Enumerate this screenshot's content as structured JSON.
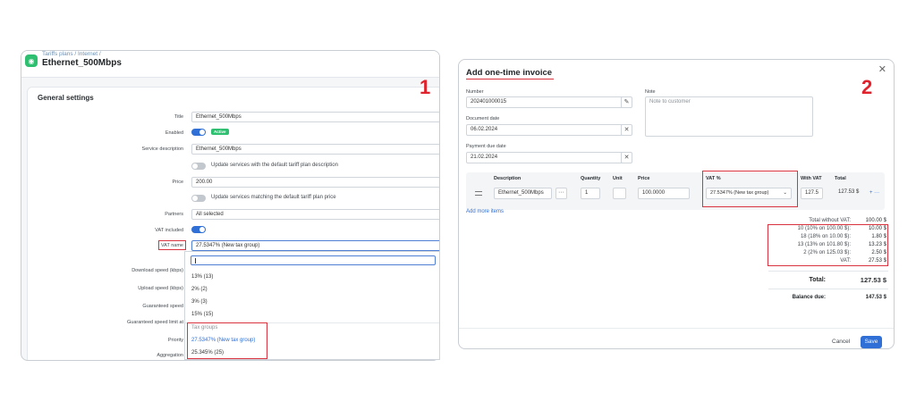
{
  "panel1": {
    "breadcrumb": "Tariffs plans / Internet /",
    "title": "Ethernet_500Mbps",
    "section_title": "General settings",
    "callout_number": "1",
    "fields": {
      "title_label": "Title",
      "title_value": "Ethernet_500Mbps",
      "enabled_label": "Enabled",
      "enabled_badge": "Active",
      "service_desc_label": "Service description",
      "service_desc_value": "Ethernet_500Mbps",
      "update_desc_toggle_label": "Update services with the default tariff plan description",
      "price_label": "Price",
      "price_value": "200.00",
      "update_price_toggle_label": "Update services matching the default tariff plan price",
      "partners_label": "Partners",
      "partners_value": "All selected",
      "vat_included_label": "VAT included",
      "vat_name_label": "VAT name",
      "vat_name_value": "27.5347% (New tax group)",
      "download_label": "Download speed (kbps)",
      "upload_label": "Upload speed (kbps)",
      "guaranteed_label": "Guaranteed speed",
      "guaranteed_limit_label": "Guaranteed speed limit at",
      "priority_label": "Priority",
      "aggregation_label": "Aggregation"
    },
    "dropdown": {
      "options": [
        "13% (13)",
        "2% (2)",
        "3% (3)",
        "15% (15)"
      ],
      "group_label": "Tax groups",
      "group_options": [
        "27.5347% (New tax group)",
        "25.345% (25)"
      ]
    }
  },
  "panel2": {
    "title": "Add one-time invoice",
    "callout_number": "2",
    "number_label": "Number",
    "number_value": "202401000015",
    "document_date_label": "Document date",
    "document_date_value": "06.02.2024",
    "payment_due_label": "Payment due date",
    "payment_due_value": "21.02.2024",
    "note_label": "Note",
    "note_placeholder": "Note to customer",
    "table": {
      "headers": [
        "Description",
        "Quantity",
        "Unit",
        "Price",
        "VAT %",
        "With VAT",
        "Total"
      ],
      "row": {
        "description": "Ethernet_500Mbps",
        "quantity": "1",
        "unit": "",
        "price": "100.0000",
        "vat": "27.5347% (New tax group)",
        "with_vat": "127.5",
        "total": "127.53 $"
      }
    },
    "add_more_items": "Add more items",
    "summary": {
      "total_without_vat_label": "Total without VAT:",
      "total_without_vat_value": "100.00 $",
      "vat_lines": [
        {
          "label": "10 (10% on 100.00 $):",
          "value": "10.00 $"
        },
        {
          "label": "18 (18% on 10.00 $):",
          "value": "1.80 $"
        },
        {
          "label": "13 (13% on 101.80 $):",
          "value": "13.23 $"
        },
        {
          "label": "2 (2% on 125.03 $):",
          "value": "2.50 $"
        },
        {
          "label": "VAT:",
          "value": "27.53 $"
        }
      ],
      "total_label": "Total:",
      "total_value": "127.53 $",
      "balance_label": "Balance due:",
      "balance_value": "147.53 $"
    },
    "cancel_label": "Cancel",
    "save_label": "Save"
  },
  "colors": {
    "accent_blue": "#2f6fd6",
    "active_green": "#2fbf71",
    "highlight_red": "#d9333f",
    "callout_red": "#e0222c"
  }
}
